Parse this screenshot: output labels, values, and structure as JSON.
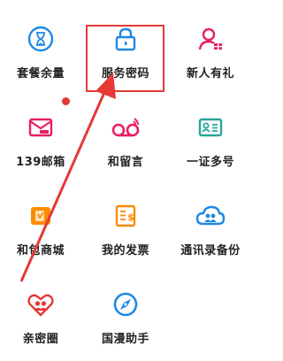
{
  "grid": {
    "items": [
      {
        "label": "套餐余量",
        "icon": "hourglass-icon"
      },
      {
        "label": "服务密码",
        "icon": "lock-icon"
      },
      {
        "label": "新人有礼",
        "icon": "user-gift-icon"
      },
      {
        "label": "139邮箱",
        "icon": "mail-icon"
      },
      {
        "label": "和留言",
        "icon": "voicemail-icon"
      },
      {
        "label": "一证多号",
        "icon": "id-card-icon"
      },
      {
        "label": "和包商城",
        "icon": "wallet-icon"
      },
      {
        "label": "我的发票",
        "icon": "invoice-icon"
      },
      {
        "label": "通讯录备份",
        "icon": "cloud-contacts-icon"
      },
      {
        "label": "亲密圈",
        "icon": "heart-people-icon"
      },
      {
        "label": "国漫助手",
        "icon": "compass-icon"
      }
    ]
  },
  "colors": {
    "icon_blue": "#1e88e5",
    "icon_pink": "#e91e63",
    "icon_green": "#26a69a",
    "icon_orange": "#fb8c00",
    "annotation_red": "#e53935"
  }
}
